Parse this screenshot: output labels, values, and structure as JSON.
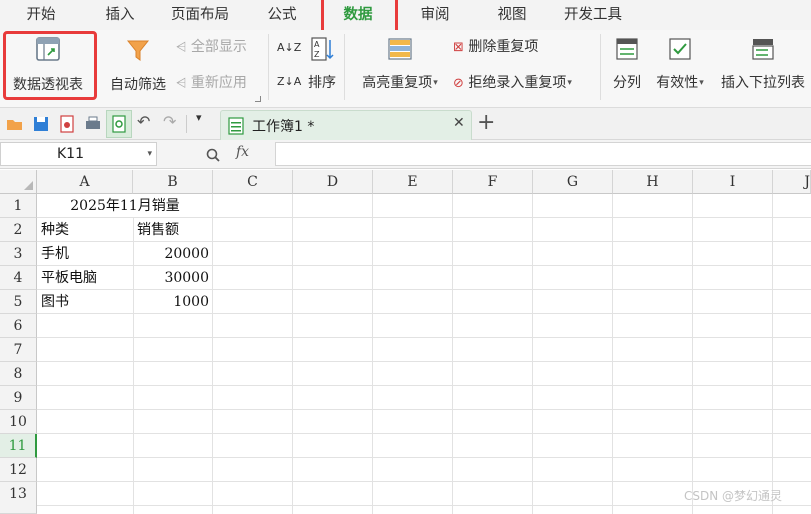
{
  "menu": {
    "tabs": [
      "开始",
      "插入",
      "页面布局",
      "公式",
      "数据",
      "审阅",
      "视图",
      "开发工具"
    ],
    "active_tab": "数据"
  },
  "ribbon": {
    "pivot_table": "数据透视表",
    "auto_filter": "自动筛选",
    "show_all": "全部显示",
    "reapply": "重新应用",
    "sort": "排序",
    "highlight_duplicates": "高亮重复项",
    "remove_duplicates": "删除重复项",
    "reject_duplicates": "拒绝录入重复项",
    "split_column": "分列",
    "validity": "有效性",
    "insert_dropdown": "插入下拉列表"
  },
  "document": {
    "tab_title": "工作簿1 *"
  },
  "formula_bar": {
    "name_box": "K11",
    "fx_label": "fx",
    "formula": ""
  },
  "sheet": {
    "columns": [
      "A",
      "B",
      "C",
      "D",
      "E",
      "F",
      "G",
      "H",
      "I",
      "J"
    ],
    "rows": [
      "1",
      "2",
      "3",
      "4",
      "5",
      "6",
      "7",
      "8",
      "9",
      "10",
      "11",
      "12",
      "13"
    ],
    "active_row": "11",
    "title": "2025年11月销量",
    "header": {
      "category": "种类",
      "sales": "销售额"
    },
    "data": [
      {
        "category": "手机",
        "sales": "20000"
      },
      {
        "category": "平板电脑",
        "sales": "30000"
      },
      {
        "category": "图书",
        "sales": "1000"
      }
    ]
  },
  "watermark": "CSDN @梦幻通灵",
  "colors": {
    "accent": "#2f9a3f",
    "highlight_border": "#e83b3b"
  }
}
